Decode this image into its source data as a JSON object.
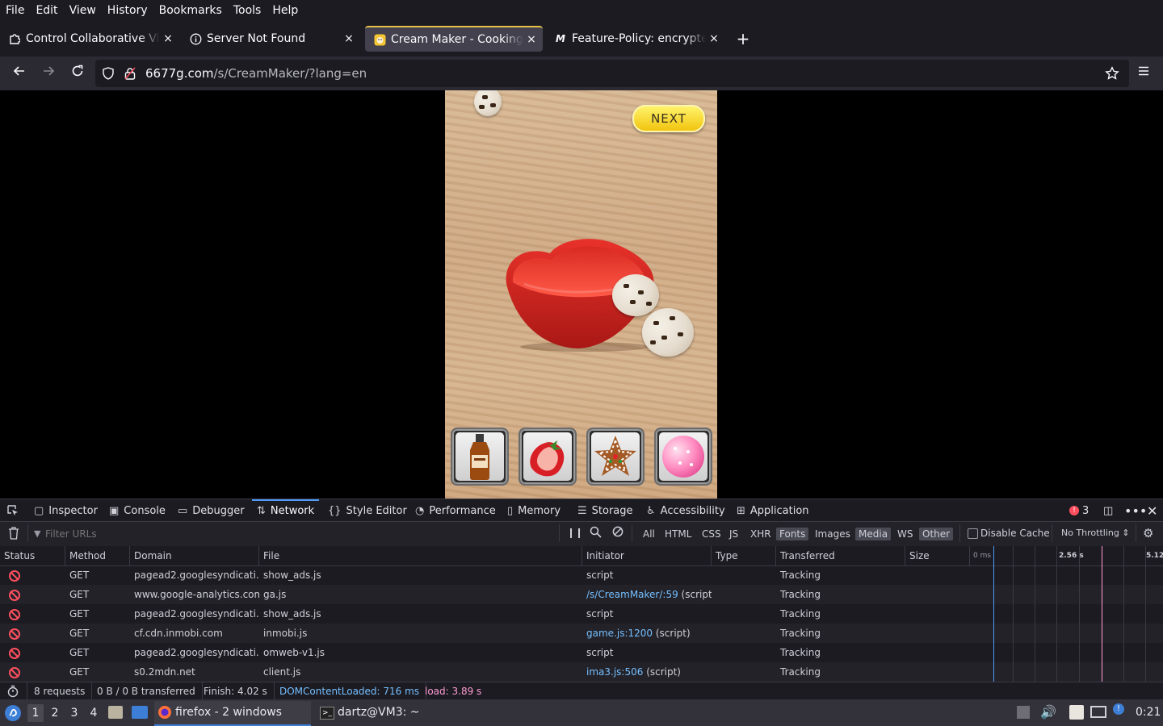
{
  "menubar": [
    "File",
    "Edit",
    "View",
    "History",
    "Bookmarks",
    "Tools",
    "Help"
  ],
  "tabs": [
    {
      "title": "Control Collaborative Virt",
      "icon": "puzzle-icon"
    },
    {
      "title": "Server Not Found",
      "icon": "info-icon"
    },
    {
      "title": "Cream Maker - Cooking G",
      "icon": "game-favicon-icon",
      "active": true
    },
    {
      "title": "Feature-Policy: encrypted",
      "icon": "mdn-icon"
    }
  ],
  "url": {
    "host": "6677g.com",
    "path": "/s/CreamMaker/?lang=en"
  },
  "game": {
    "next_label": "NEXT",
    "toppings": [
      "syrup-bottle",
      "strawberry",
      "gingerbread-star",
      "pink-candy"
    ]
  },
  "devtools": {
    "tabs": [
      "Inspector",
      "Console",
      "Debugger",
      "Network",
      "Style Editor",
      "Performance",
      "Memory",
      "Storage",
      "Accessibility",
      "Application"
    ],
    "selected_tab": "Network",
    "error_count": "3",
    "filter_placeholder": "Filter URLs",
    "types": [
      "All",
      "HTML",
      "CSS",
      "JS",
      "XHR",
      "Fonts",
      "Images",
      "Media",
      "WS",
      "Other"
    ],
    "types_on": [
      "Fonts",
      "Media",
      "Other"
    ],
    "disable_cache": "Disable Cache",
    "throttling": "No Throttling",
    "columns": [
      "Status",
      "Method",
      "Domain",
      "File",
      "Initiator",
      "Type",
      "Transferred",
      "Size"
    ],
    "timeline_ticks": [
      "0 ms",
      "2.56 s",
      "5.12"
    ],
    "requests": [
      {
        "method": "GET",
        "domain": "pagead2.googlesyndicati...",
        "file": "show_ads.js",
        "initiator": "script",
        "initiator_link": "",
        "transferred": "Tracking"
      },
      {
        "method": "GET",
        "domain": "www.google-analytics.com",
        "file": "ga.js",
        "initiator": "(script)",
        "initiator_link": "/s/CreamMaker/:59",
        "transferred": "Tracking"
      },
      {
        "method": "GET",
        "domain": "pagead2.googlesyndicati...",
        "file": "show_ads.js",
        "initiator": "script",
        "initiator_link": "",
        "transferred": "Tracking"
      },
      {
        "method": "GET",
        "domain": "cf.cdn.inmobi.com",
        "file": "inmobi.js",
        "initiator": "(script)",
        "initiator_link": "game.js:1200",
        "transferred": "Tracking"
      },
      {
        "method": "GET",
        "domain": "pagead2.googlesyndicati...",
        "file": "omweb-v1.js",
        "initiator": "script",
        "initiator_link": "",
        "transferred": "Tracking"
      },
      {
        "method": "GET",
        "domain": "s0.2mdn.net",
        "file": "client.js",
        "initiator": "(script)",
        "initiator_link": "ima3.js:506",
        "transferred": "Tracking"
      }
    ],
    "status": {
      "requests": "8 requests",
      "transferred": "0 B / 0 B transferred",
      "finish": "Finish: 4.02 s",
      "dcl": "DOMContentLoaded: 716 ms",
      "load": "load: 3.89 s"
    }
  },
  "taskbar": {
    "workspaces": [
      "1",
      "2",
      "3",
      "4"
    ],
    "active_workspace": "1",
    "firefox": "firefox - 2 windows",
    "terminal": "dartz@VM3: ~",
    "clock": "0:21"
  },
  "colors": {
    "accent": "#4f9cf9",
    "blocked": "#ff4f5e",
    "dcl": "#75bfff",
    "load": "#ff9bd3",
    "next_button": "#f1c40f"
  }
}
